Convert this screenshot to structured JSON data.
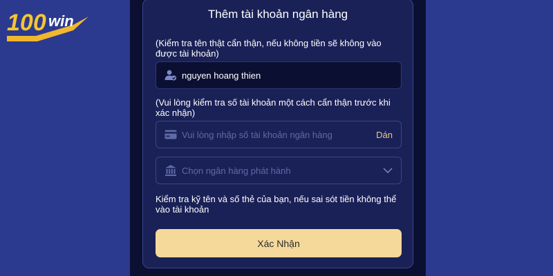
{
  "logo": {
    "text": "100win"
  },
  "form": {
    "title": "Thêm tài khoản ngân hàng",
    "name_note": "(Kiểm tra tên thật cẩn thận, nếu không tiền sẽ không vào được tài khoản)",
    "name_value": "nguyen hoang thien",
    "account_note": "(Vui lòng kiểm tra số tài khoản một cách cẩn thận trước khi xác nhận)",
    "account_placeholder": "Vui lòng nhập số tài khoản ngân hàng",
    "paste_label": "Dán",
    "bank_placeholder": "Chọn ngân hàng phát hành",
    "check_note": "Kiểm tra kỹ tên và số thẻ của bạn, nếu sai sót tiền không thể vào tài khoản",
    "submit_label": "Xác Nhận"
  },
  "icons": [
    "user-check-icon",
    "card-icon",
    "bank-icon",
    "chevron-down-icon"
  ],
  "colors": {
    "page_bg": "#2b3a8f",
    "panel_bg": "#0b1032",
    "card_bg": "#1a2157",
    "accent": "#f5d99b",
    "paste": "#e8c98a"
  }
}
